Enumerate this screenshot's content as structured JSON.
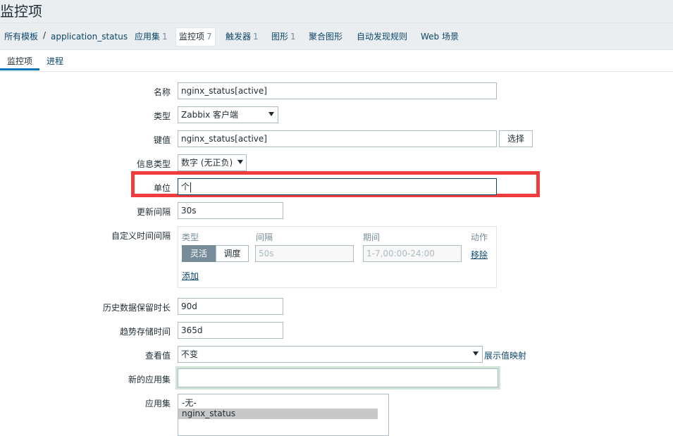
{
  "page_title": "监控项",
  "breadcrumb": {
    "all_templates": "所有模板",
    "separator": "/",
    "template": "application_status"
  },
  "nav_tabs": [
    {
      "label": "应用集",
      "count": "1"
    },
    {
      "label": "监控项",
      "count": "7"
    },
    {
      "label": "触发器",
      "count": "1"
    },
    {
      "label": "图形",
      "count": "1"
    },
    {
      "label": "聚合图形",
      "count": ""
    },
    {
      "label": "自动发现规则",
      "count": ""
    },
    {
      "label": "Web 场景",
      "count": ""
    }
  ],
  "sub_tabs": {
    "item": "监控项",
    "process": "进程"
  },
  "form": {
    "name": {
      "label": "名称",
      "value": "nginx_status[active]"
    },
    "type": {
      "label": "类型",
      "value": "Zabbix 客户端"
    },
    "key": {
      "label": "键值",
      "value": "nginx_status[active]",
      "button": "选择"
    },
    "info_type": {
      "label": "信息类型",
      "value": "数字 (无正负)"
    },
    "units": {
      "label": "单位",
      "value": "个"
    },
    "update_interval": {
      "label": "更新间隔",
      "value": "30s"
    },
    "custom_intervals": {
      "label": "自定义时间间隔",
      "col_type": "类型",
      "col_interval": "间隔",
      "col_period": "期间",
      "col_action": "动作",
      "seg_flexible": "灵活",
      "seg_scheduling": "调度",
      "interval_placeholder": "50s",
      "period_placeholder": "1-7,00:00-24:00",
      "remove": "移除",
      "add": "添加"
    },
    "history": {
      "label": "历史数据保留时长",
      "value": "90d"
    },
    "trends": {
      "label": "趋势存储时间",
      "value": "365d"
    },
    "valuemap": {
      "label": "查看值",
      "value": "不变",
      "link": "展示值映射"
    },
    "new_application": {
      "label": "新的应用集",
      "value": ""
    },
    "applications": {
      "label": "应用集",
      "options": [
        "-无-",
        "nginx_status"
      ],
      "selected": "nginx_status"
    }
  },
  "colors": {
    "link": "#0a466a",
    "highlight": "#ef3c3c",
    "focus_border": "#cfe6d6",
    "active_tab_underline": "#0275b8"
  }
}
